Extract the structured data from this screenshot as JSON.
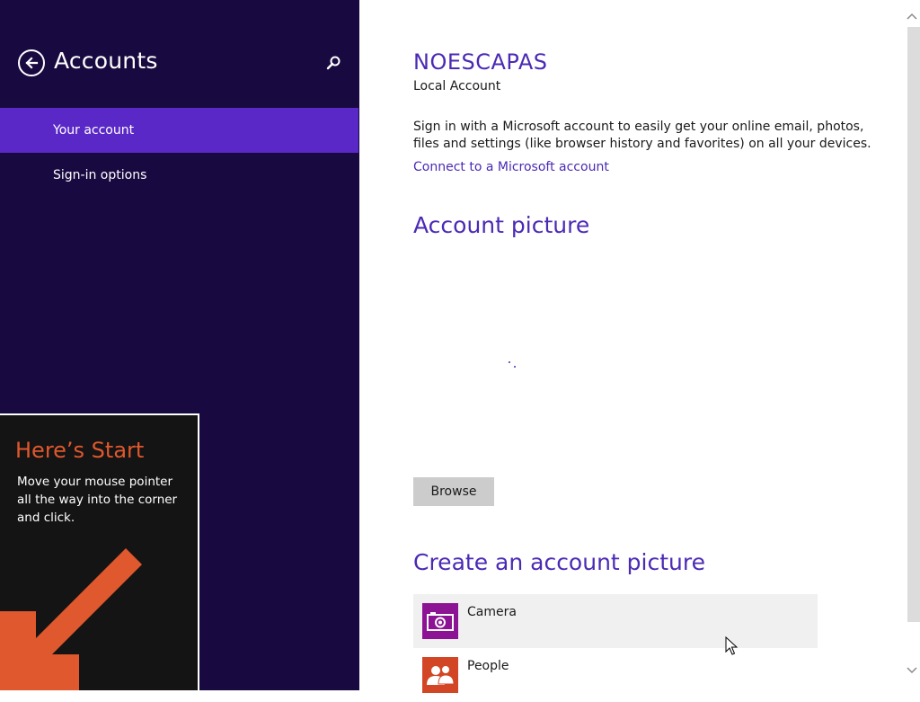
{
  "sidebar": {
    "title": "Accounts",
    "back_icon": "back-arrow-icon",
    "search_icon": "search-icon",
    "items": [
      {
        "label": "Your account",
        "selected": true
      },
      {
        "label": "Sign-in options",
        "selected": false
      }
    ]
  },
  "tip": {
    "title": "Here’s Start",
    "body": "Move your mouse pointer all the way into the corner and click.",
    "arrow_icon": "corner-arrow-icon"
  },
  "account": {
    "name": "NOESCAPAS",
    "type": "Local Account",
    "signin_text": "Sign in with a Microsoft account to easily get your online email, photos, files and settings (like browser history and favorites) on all your devices.",
    "connect_link": "Connect to a Microsoft account"
  },
  "picture": {
    "heading": "Account picture",
    "browse_label": "Browse"
  },
  "create": {
    "heading": "Create an account picture",
    "apps": [
      {
        "label": "Camera",
        "icon": "camera-icon",
        "color": "#8b1394"
      },
      {
        "label": "People",
        "icon": "people-icon",
        "color": "#d24625"
      }
    ]
  },
  "colors": {
    "sidebar_bg": "#180a40",
    "selected_bg": "#5a28c6",
    "accent": "#4b2ab5",
    "tip_title": "#e0582d"
  }
}
